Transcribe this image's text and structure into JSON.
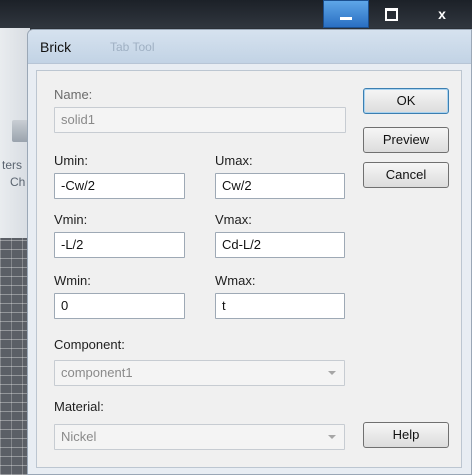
{
  "background": {
    "fragment_1": "ters",
    "fragment_2": "Ch"
  },
  "dialog": {
    "title": "Brick",
    "title_ghost": "Tab Tool"
  },
  "form": {
    "name": {
      "label": "Name:",
      "value": "solid1"
    },
    "umin": {
      "label": "Umin:",
      "value": "-Cw/2"
    },
    "umax": {
      "label": "Umax:",
      "value": "Cw/2"
    },
    "vmin": {
      "label": "Vmin:",
      "value": "-L/2"
    },
    "vmax": {
      "label": "Vmax:",
      "value": "Cd-L/2"
    },
    "wmin": {
      "label": "Wmin:",
      "value": "0"
    },
    "wmax": {
      "label": "Wmax:",
      "value": "t"
    },
    "component": {
      "label": "Component:",
      "value": "component1"
    },
    "material": {
      "label": "Material:",
      "value": "Nickel"
    }
  },
  "buttons": {
    "ok": "OK",
    "preview": "Preview",
    "cancel": "Cancel",
    "help": "Help"
  },
  "window_controls": {
    "close": "x"
  }
}
